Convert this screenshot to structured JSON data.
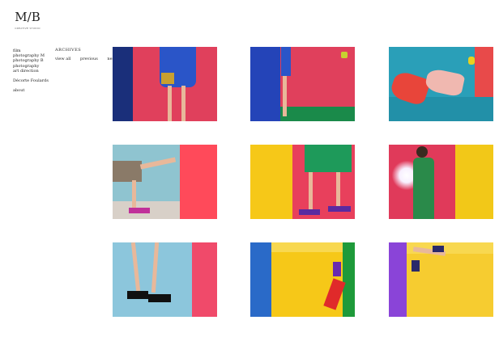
{
  "logo": {
    "mark": "M/B",
    "subtitle": "CREATIVE STUDIO"
  },
  "nav": {
    "items": [
      "film",
      "photography M",
      "photography B",
      "photography",
      "art direction"
    ],
    "extra": [
      "Décorte Foulards"
    ],
    "about": "about"
  },
  "archive": {
    "title": "ARCHIVES",
    "links": [
      "view all",
      "previous",
      "next"
    ]
  },
  "gallery": [
    {
      "id": 1,
      "theme": "pink-blue-legs",
      "colors": [
        "#1a2f7a",
        "#e0405c",
        "#2a55c8"
      ]
    },
    {
      "id": 2,
      "theme": "blue-pink-green",
      "colors": [
        "#2444b8",
        "#e0405c",
        "#1a8a4a"
      ]
    },
    {
      "id": 3,
      "theme": "teal-red-shoes",
      "colors": [
        "#2a9fb8",
        "#e8453a",
        "#e84a4a"
      ]
    },
    {
      "id": 4,
      "theme": "blue-wall-kick",
      "colors": [
        "#8fc4d0",
        "#ff4a5a",
        "#d8d0c8"
      ]
    },
    {
      "id": 5,
      "theme": "yellow-pink-green",
      "colors": [
        "#f6c818",
        "#e8405c",
        "#1e9a5a"
      ]
    },
    {
      "id": 6,
      "theme": "pink-flash-yellow",
      "colors": [
        "#e03a5a",
        "#f2c818",
        "#2a8a4a"
      ]
    },
    {
      "id": 7,
      "theme": "lightblue-pink-sandals",
      "colors": [
        "#8cc6dc",
        "#f04a6a",
        "#101010"
      ]
    },
    {
      "id": 8,
      "theme": "blue-yellow-red",
      "colors": [
        "#2a6ac8",
        "#f6c818",
        "#e02a2a"
      ]
    },
    {
      "id": 9,
      "theme": "purple-yellow-legs",
      "colors": [
        "#8a44d8",
        "#f6cc30",
        "#2a2a6a"
      ]
    }
  ]
}
